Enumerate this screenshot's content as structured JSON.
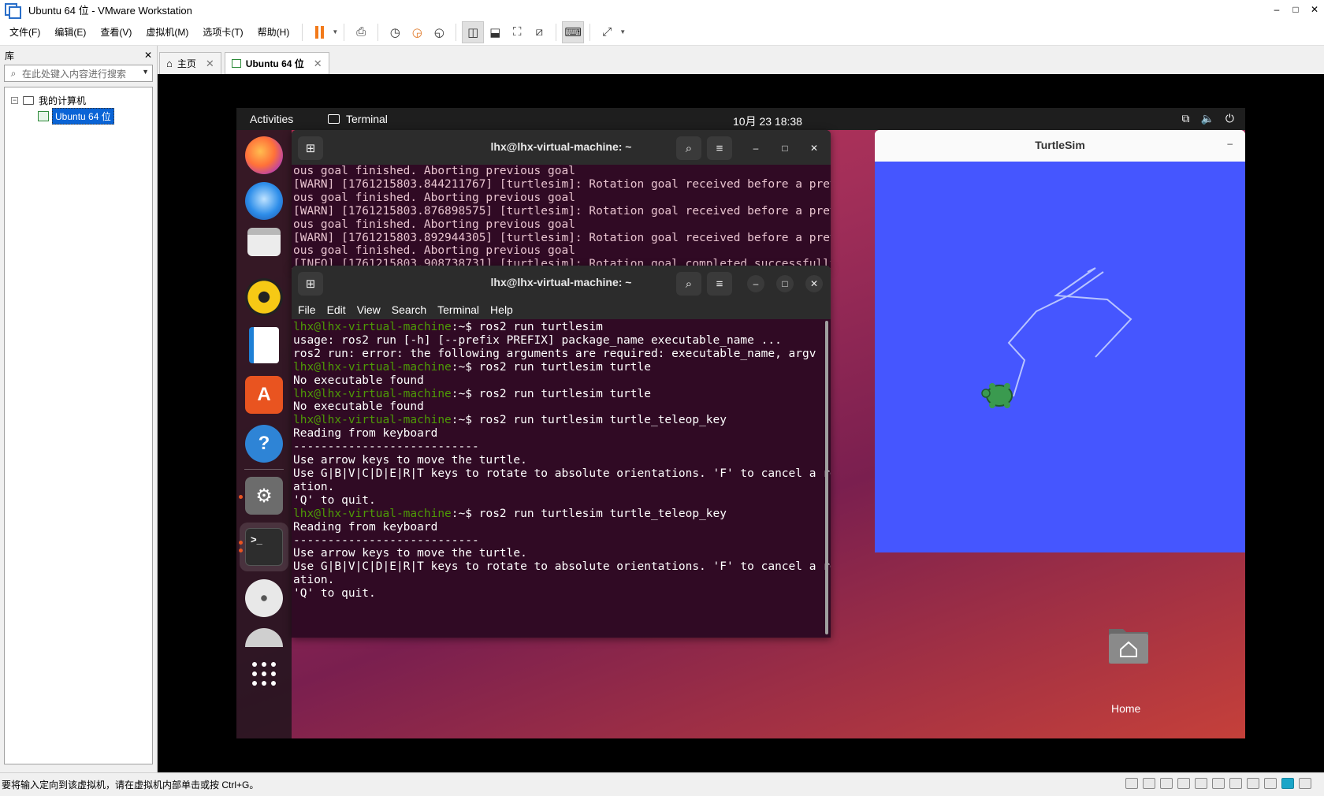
{
  "window": {
    "title": "Ubuntu 64 位 - VMware Workstation",
    "controls": [
      "–",
      "□",
      "✕"
    ]
  },
  "menubar": {
    "items": [
      "文件(F)",
      "编辑(E)",
      "查看(V)",
      "虚拟机(M)",
      "选项卡(T)",
      "帮助(H)"
    ]
  },
  "library": {
    "title": "库",
    "close": "✕",
    "search_placeholder": "在此处键入内容进行搜索",
    "tree": {
      "root": "我的计算机",
      "child": "Ubuntu 64 位"
    }
  },
  "tabs": [
    {
      "label": "主页",
      "icon": "home-icon"
    },
    {
      "label": "Ubuntu 64 位",
      "icon": "vm-icon"
    }
  ],
  "ubuntu": {
    "topbar": {
      "activities": "Activities",
      "app": "Terminal",
      "clock": "10月 23  18:38"
    },
    "terminal_bg": {
      "title": "lhx@lhx-virtual-machine: ~",
      "lines": [
        "ous goal finished. Aborting previous goal",
        "[WARN] [1761215803.844211767] [turtlesim]: Rotation goal received before a previ",
        "ous goal finished. Aborting previous goal",
        "[WARN] [1761215803.876898575] [turtlesim]: Rotation goal received before a previ",
        "ous goal finished. Aborting previous goal",
        "[WARN] [1761215803.892944305] [turtlesim]: Rotation goal received before a previ",
        "ous goal finished. Aborting previous goal",
        "[INFO] [1761215803.908738731] [turtlesim]: Rotation goal completed successfully"
      ]
    },
    "terminal_fg": {
      "title": "lhx@lhx-virtual-machine: ~",
      "menu": [
        "File",
        "Edit",
        "View",
        "Search",
        "Terminal",
        "Help"
      ],
      "prompt_user": "lhx@lhx-virtual-machine",
      "prompt_suffix": ":~$",
      "lines": [
        {
          "type": "cmd",
          "text": " ros2 run turtlesim"
        },
        {
          "type": "out",
          "text": "usage: ros2 run [-h] [--prefix PREFIX] package_name executable_name ..."
        },
        {
          "type": "out",
          "text": "ros2 run: error: the following arguments are required: executable_name, argv"
        },
        {
          "type": "cmd",
          "text": " ros2 run turtlesim turtle"
        },
        {
          "type": "out",
          "text": "No executable found"
        },
        {
          "type": "cmd",
          "text": " ros2 run turtlesim turtle"
        },
        {
          "type": "out",
          "text": "No executable found"
        },
        {
          "type": "cmd",
          "text": " ros2 run turtlesim turtle_teleop_key"
        },
        {
          "type": "out",
          "text": "Reading from keyboard"
        },
        {
          "type": "out",
          "text": "---------------------------"
        },
        {
          "type": "out",
          "text": "Use arrow keys to move the turtle."
        },
        {
          "type": "out",
          "text": "Use G|B|V|C|D|E|R|T keys to rotate to absolute orientations. 'F' to cancel a rot"
        },
        {
          "type": "out",
          "text": "ation."
        },
        {
          "type": "out",
          "text": "'Q' to quit."
        },
        {
          "type": "cmd",
          "text": " ros2 run turtlesim turtle_teleop_key"
        },
        {
          "type": "out",
          "text": "Reading from keyboard"
        },
        {
          "type": "out",
          "text": "---------------------------"
        },
        {
          "type": "out",
          "text": "Use arrow keys to move the turtle."
        },
        {
          "type": "out",
          "text": "Use G|B|V|C|D|E|R|T keys to rotate to absolute orientations. 'F' to cancel a rot"
        },
        {
          "type": "out",
          "text": "ation."
        },
        {
          "type": "out",
          "text": "'Q' to quit."
        }
      ]
    },
    "turtlesim": {
      "title": "TurtleSim",
      "minimize": "–",
      "background": "#4556ff"
    },
    "desktop": {
      "home_label": "Home"
    }
  },
  "statusbar": {
    "message": "要将输入定向到该虚拟机，请在虚拟机内部单击或按 Ctrl+G。"
  }
}
